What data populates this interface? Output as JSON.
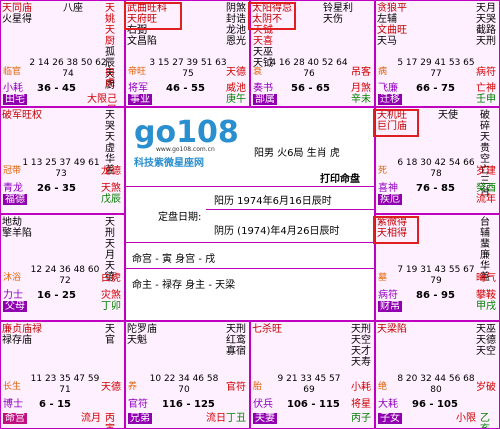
{
  "cells": {
    "si": {
      "main": [
        "天同庙",
        "火星得"
      ],
      "aux": [
        "八座"
      ],
      "mid": [
        "天姚",
        "天厨",
        "孤辰",
        "天厨"
      ],
      "nums": "2 14 26 38 50 62\n74",
      "range": "36 - 45",
      "left_lbl": "临官",
      "left_star": "小耗",
      "left_gong": "田宅",
      "right_lbl": "白虎",
      "right_star": "大限",
      "right_gz": "己巳"
    },
    "wu": {
      "main": [
        "武曲旺科",
        "天府旺"
      ],
      "mid": [
        "右弼",
        "文昌陷"
      ],
      "right": [
        "阴煞",
        "封诰",
        "龙池",
        "恩光"
      ],
      "nums": "3 15 27 39 51 63\n75",
      "range": "46 - 55",
      "left_lbl": "帝旺",
      "left_star": "将军",
      "left_gong": "事业",
      "right_lbl": "天德",
      "right_star": "威池",
      "right_gz": "庚午"
    },
    "wei": {
      "main": [
        "太阳得忌",
        "太阴不"
      ],
      "mid": [
        "天钺",
        "天喜",
        "天巫",
        "天钺"
      ],
      "right": [
        "铃星利",
        "天伤"
      ],
      "nums": "4 16 28 40 52 64\n76",
      "range": "56 - 65",
      "left_lbl": "衰",
      "left_star": "奏书",
      "left_gong": "部属",
      "right_lbl": "吊客",
      "right_star": "月煞",
      "right_gz": "辛未"
    },
    "shen": {
      "main": [
        "贪狼平",
        "左辅",
        "文曲旺",
        "天马"
      ],
      "right": [
        "天月",
        "天哭",
        "截路",
        "天刑"
      ],
      "nums": "5 17 29 41 53 65\n77",
      "range": "66 - 75",
      "left_lbl": "病",
      "left_star": "飞廉",
      "left_gong": "迁移",
      "right_lbl": "病符",
      "right_star": "亡神",
      "right_gz": "壬申"
    },
    "chen": {
      "main": [
        "破军旺权"
      ],
      "right": [
        "天哭",
        "天虚",
        "华盖"
      ],
      "nums": "1 13 25 37 49 61\n73",
      "range": "26 - 35",
      "left_lbl": "冠带",
      "left_star": "青龙",
      "left_gong": "福德",
      "right_lbl": "龙德",
      "right_star": "天煞",
      "right_gz": "戊辰"
    },
    "you": {
      "main": [
        "天机旺",
        "巨门庙"
      ],
      "right": [
        "天使",
        "破碎",
        "天贵",
        "空亡",
        "三台"
      ],
      "nums": "6 18 30 42 54 66\n78",
      "range": "76 - 85",
      "left_lbl": "死",
      "left_star": "喜神",
      "left_gong": "疾厄",
      "right_lbl": "岁建",
      "right_star": "流年",
      "right_gz": "癸酉"
    },
    "mao": {
      "main": [
        "地劫",
        "擎羊陷"
      ],
      "right": [
        "天刑",
        "天月",
        "天德"
      ],
      "nums": "12 24 36 48 60\n72",
      "range": "16 - 25",
      "left_lbl": "沐浴",
      "left_star": "力士",
      "left_gong": "父母",
      "right_lbl": "白虎",
      "right_star": "灾煞",
      "right_gz": "丁卯"
    },
    "xu": {
      "main": [
        "紫微得",
        "天相得"
      ],
      "right": [
        "台辅",
        "蜚廉",
        "华盖"
      ],
      "nums": "7 19 31 43 55 67\n79",
      "range": "86 - 95",
      "left_lbl": "墓",
      "left_star": "病符",
      "left_gong": "财帛",
      "right_lbl": "晦气",
      "right_star": "攀鞍",
      "right_gz": "甲戌"
    },
    "yin": {
      "main": [
        "廉贞庙禄",
        "禄存庙"
      ],
      "right": [
        "天官"
      ],
      "nums": "11 23 35 47 59\n71",
      "range": "6 - 15",
      "left_lbl": "长生",
      "left_star": "博士",
      "left_gong": "命宫",
      "right_lbl": "天德",
      "right_star": "流月",
      "right_gz": "丙寅"
    },
    "chou": {
      "main": [
        "陀罗庙"
      ],
      "mid": [
        "天魁"
      ],
      "right": [
        "天刑",
        "红鸾",
        "寡宿"
      ],
      "nums": "10 22 34 46 58\n70",
      "range": "116 - 125",
      "left_lbl": "养",
      "left_star": "官符",
      "left_gong": "兄弟",
      "right_lbl": "官符",
      "right_star": "流日",
      "right_gz": "丁丑"
    },
    "zi": {
      "main": [
        "七杀旺"
      ],
      "right": [
        "天刑",
        "天空",
        "天才",
        "天寿"
      ],
      "nums": "9 21 33 45 57\n69",
      "range": "106 - 115",
      "left_lbl": "胎",
      "left_star": "伏兵",
      "left_gong": "夫妻",
      "right_lbl": "小耗",
      "right_star": "将星",
      "right_gz": "丙子"
    },
    "hai": {
      "main": [
        "天梁陷"
      ],
      "right": [
        "天巫",
        "天德",
        "天空"
      ],
      "nums": "8 20 32 44 56 68\n80",
      "range": "96 - 105",
      "left_lbl": "绝",
      "left_star": "大耗",
      "left_gong": "子女",
      "right_lbl": "岁破",
      "right_star": "小限",
      "right_gz": "乙亥"
    }
  },
  "center": {
    "logo": "go108",
    "url": "www.go108.com.cn",
    "site": "科技紫微星座网",
    "person": "阳男 火6局 生肖 虎",
    "print": "打印命盘",
    "date_label": "定盘日期:",
    "solar": "阳历 1974年6月16日辰时",
    "lunar": "阴历 (1974)年4月26日辰时",
    "ming": "命宫 - 寅 身宫 - 戌",
    "zhu": "命主 - 禄存 身主 - 天梁"
  }
}
